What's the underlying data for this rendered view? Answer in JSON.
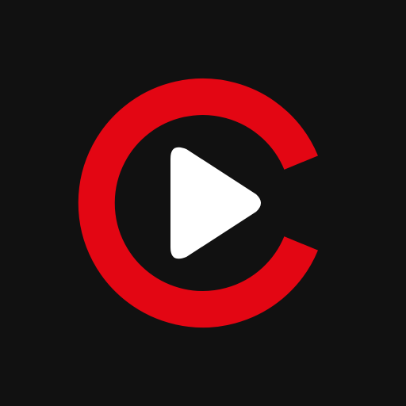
{
  "logo": {
    "name": "play-logo-icon",
    "colors": {
      "background": "#111111",
      "ring": "#E30613",
      "play": "#FFFFFF"
    }
  }
}
